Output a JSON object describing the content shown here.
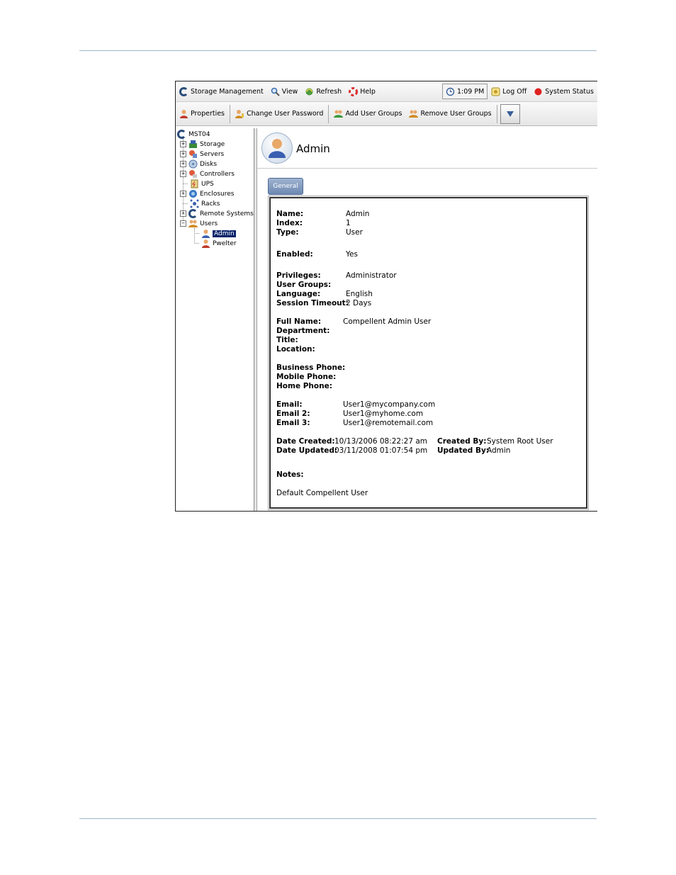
{
  "toolbar1": {
    "storage_management": "Storage Management",
    "view": "View",
    "refresh": "Refresh",
    "help": "Help",
    "time": "1:09 PM",
    "log_off": "Log Off",
    "system_status": "System Status"
  },
  "toolbar2": {
    "properties": "Properties",
    "change_password": "Change User Password",
    "add_groups": "Add User Groups",
    "remove_groups": "Remove User Groups"
  },
  "tree": {
    "root": "MST04",
    "items": [
      "Storage",
      "Servers",
      "Disks",
      "Controllers",
      "UPS",
      "Enclosures",
      "Racks",
      "Remote Systems",
      "Users"
    ],
    "users": [
      "Admin",
      "Pwelter"
    ]
  },
  "header": {
    "title": "Admin"
  },
  "tab": {
    "general": "General"
  },
  "details": {
    "name_label": "Name:",
    "name": "Admin",
    "index_label": "Index:",
    "index": "1",
    "type_label": "Type:",
    "type": "User",
    "enabled_label": "Enabled:",
    "enabled": "Yes",
    "privileges_label": "Privileges:",
    "privileges": "Administrator",
    "user_groups_label": "User Groups:",
    "language_label": "Language:",
    "language": "English",
    "session_timeout_label": "Session Timeout:",
    "session_timeout": "2 Days",
    "full_name_label": "Full Name:",
    "full_name": "Compellent Admin User",
    "department_label": "Department:",
    "title_label": "Title:",
    "location_label": "Location:",
    "business_phone_label": "Business Phone:",
    "mobile_phone_label": "Mobile Phone:",
    "home_phone_label": "Home Phone:",
    "email_label": "Email:",
    "email": "User1@mycompany.com",
    "email2_label": "Email 2:",
    "email2": "User1@myhome.com",
    "email3_label": "Email 3:",
    "email3": "User1@remotemail.com",
    "date_created_label": "Date Created:",
    "date_created": "10/13/2006 08:22:27 am",
    "date_updated_label": "Date Updated:",
    "date_updated": "03/11/2008 01:07:54 pm",
    "created_by_label": "Created By:",
    "created_by": "System Root User",
    "updated_by_label": "Updated By:",
    "updated_by": "Admin",
    "notes_label": "Notes:",
    "notes": "Default Compellent User"
  },
  "colors": {
    "selection": "#0a246a",
    "status_red": "#e02020",
    "rule": "#9fb7c7"
  }
}
